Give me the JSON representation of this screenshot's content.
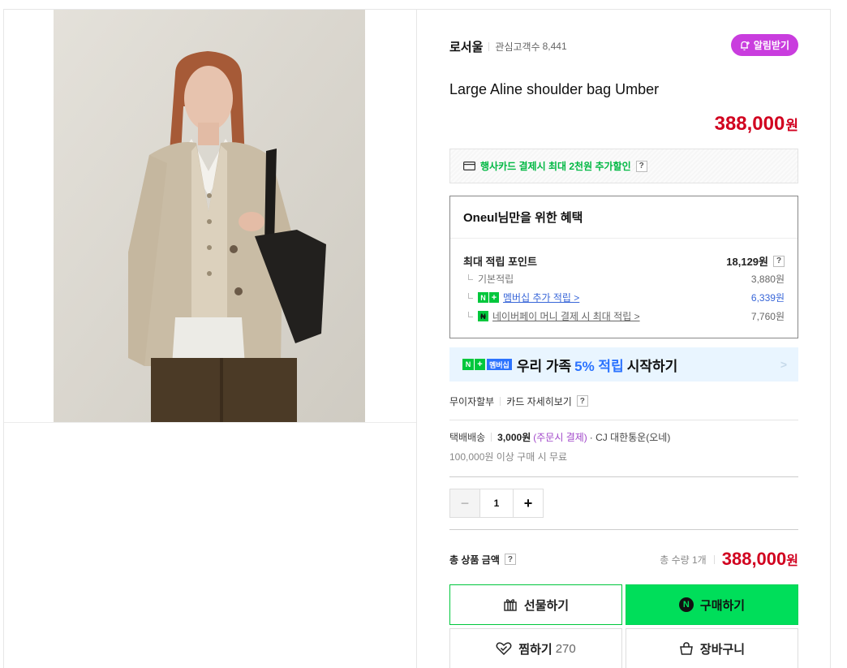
{
  "store": {
    "name": "로서울",
    "fans_label": "관심고객수",
    "fans_count": "8,441",
    "alarm_label": "알림받기"
  },
  "product": {
    "title": "Large Aline shoulder bag Umber",
    "price": "388,000",
    "price_unit": "원"
  },
  "card_promo": {
    "text": "행사카드 결제시 최대 2천원 추가할인",
    "help": "?"
  },
  "benefits": {
    "heading": "Oneul님만을 위한 혜택",
    "max_points_label": "최대 적립 포인트",
    "max_points_value": "18,129원",
    "help": "?",
    "basic_label": "기본적립",
    "basic_value": "3,880원",
    "membership_label": "멤버십 추가 적립 >",
    "membership_value": "6,339원",
    "npay_label": "네이버페이 머니 결제 시 최대 적립 >",
    "npay_value": "7,760원"
  },
  "member_banner": {
    "badge_n": "N",
    "badge_plus": "+",
    "badge_text": "멤버십",
    "text_before": "우리 가족",
    "highlight": "5% 적립",
    "text_after": "시작하기",
    "arrow": ">"
  },
  "installment": {
    "label1": "무이자할부",
    "label2": "카드 자세히보기",
    "help": "?"
  },
  "shipping": {
    "type": "택배배송",
    "fee": "3,000원",
    "fee_note": "(주문시 결제)",
    "carrier": "· CJ 대한통운(오네)",
    "free_note": "100,000원 이상 구매 시 무료"
  },
  "quantity": {
    "minus": "−",
    "value": "1",
    "plus": "+"
  },
  "total": {
    "label": "총 상품 금액",
    "help": "?",
    "qty_text": "총 수량 1개",
    "price": "388,000",
    "unit": "원"
  },
  "actions": {
    "gift": "선물하기",
    "buy": "구매하기",
    "buy_icon": "N",
    "zzim": "찜하기",
    "zzim_count": "270",
    "cart": "장바구니"
  },
  "colors": {
    "price_red": "#d1001f",
    "naver_green": "#00de5a",
    "alarm_purple": "#c93dde",
    "member_blue": "#2b73ff"
  }
}
